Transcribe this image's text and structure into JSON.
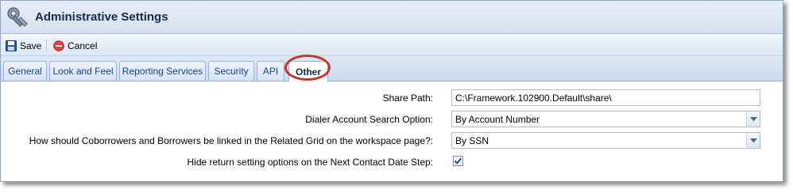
{
  "window": {
    "title": "Administrative Settings",
    "icon": "wrench-gear-icon"
  },
  "toolbar": {
    "save_label": "Save",
    "save_icon": "floppy-disk-icon",
    "cancel_label": "Cancel",
    "cancel_icon": "cancel-circle-icon"
  },
  "tabs": [
    {
      "label": "General",
      "active": false
    },
    {
      "label": "Look and Feel",
      "active": false
    },
    {
      "label": "Reporting Services",
      "active": false
    },
    {
      "label": "Security",
      "active": false
    },
    {
      "label": "API",
      "active": false
    },
    {
      "label": "Other",
      "active": true
    }
  ],
  "form": {
    "share_path": {
      "label": "Share Path:",
      "value": "C:\\Framework.102900.Default\\share\\"
    },
    "dialer_search": {
      "label": "Dialer Account Search Option:",
      "value": "By Account Number"
    },
    "coborrower_link": {
      "label": "How should Coborrowers and Borrowers be linked in the Related Grid on the workspace page?:",
      "value": "By SSN"
    },
    "hide_return": {
      "label": "Hide return setting options on the Next Contact Date Step:",
      "checked": true
    }
  },
  "colors": {
    "accent": "#15428b",
    "highlight_ring": "#c0392b"
  }
}
